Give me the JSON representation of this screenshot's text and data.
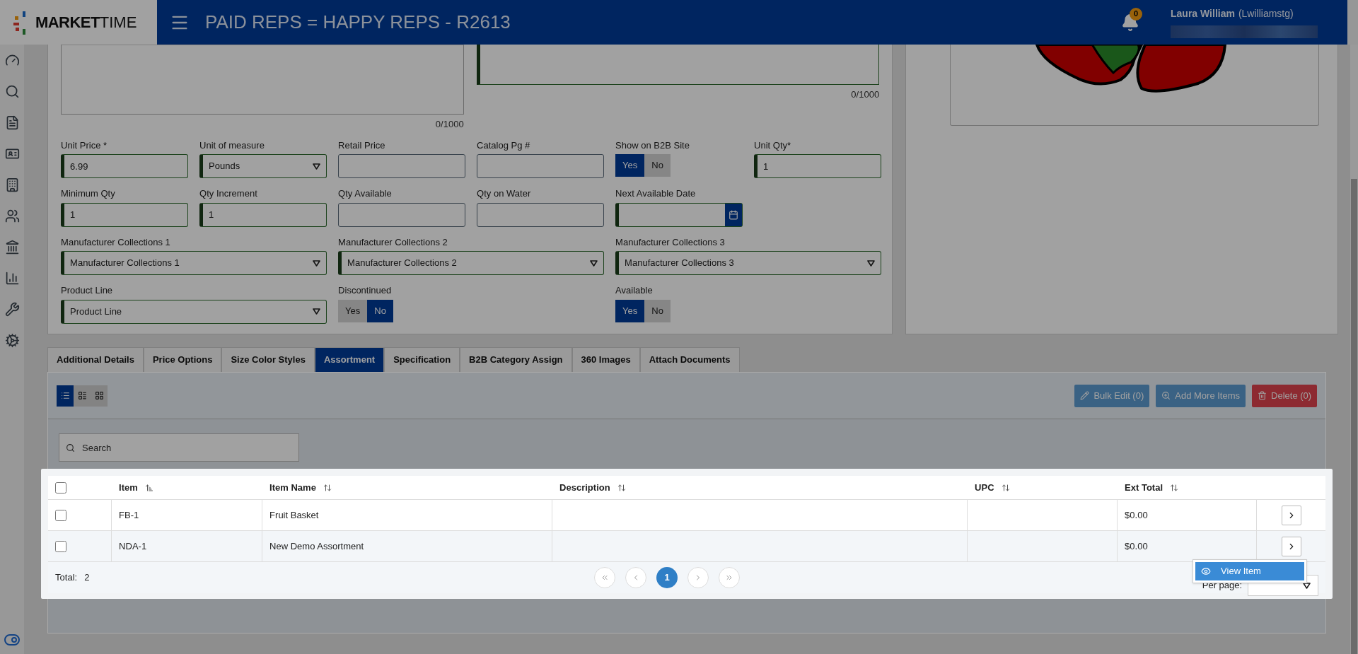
{
  "header": {
    "brand_bold": "MARKET",
    "brand_light": "TIME",
    "title": "PAID REPS = HAPPY REPS - R2613",
    "notification_count": "0",
    "user_name": "Laura William",
    "user_login": "(Lwilliamstg)"
  },
  "form": {
    "counters": [
      "0/1000",
      "0/1000"
    ],
    "rows": [
      [
        {
          "kind": "input",
          "label": "Unit Price *",
          "value": "6.99",
          "validated": true
        },
        {
          "kind": "select",
          "label": "Unit of measure",
          "value": "Pounds",
          "validated": true
        },
        {
          "kind": "input",
          "label": "Retail Price",
          "validated": false
        },
        {
          "kind": "input",
          "label": "Catalog Pg #",
          "validated": false
        },
        {
          "kind": "toggle",
          "label": "Show on B2B Site",
          "options": [
            {
              "label": "Yes",
              "selected": true
            },
            {
              "label": "No",
              "selected": false
            }
          ]
        },
        {
          "kind": "input",
          "label": "Unit Qty*",
          "value": "1",
          "validated": true
        }
      ],
      [
        {
          "kind": "input",
          "label": "Minimum Qty",
          "value": "1",
          "validated": true
        },
        {
          "kind": "input",
          "label": "Qty Increment",
          "value": "1",
          "validated": true
        },
        {
          "kind": "input",
          "label": "Qty Available",
          "validated": false
        },
        {
          "kind": "input",
          "label": "Qty on Water",
          "validated": false
        },
        {
          "kind": "date",
          "label": "Next Available Date",
          "validated": true
        }
      ],
      [
        {
          "kind": "select",
          "label": "Manufacturer Collections 1",
          "value": "Manufacturer Collections 1",
          "validated": true
        },
        {
          "kind": "select",
          "label": "Manufacturer Collections 2",
          "value": "Manufacturer Collections 2",
          "validated": true
        },
        {
          "kind": "select",
          "label": "Manufacturer Collections 3",
          "value": "Manufacturer Collections 3",
          "validated": true
        }
      ],
      [
        {
          "kind": "select",
          "label": "Product Line",
          "value": "Product Line",
          "validated": true
        },
        {
          "kind": "toggle",
          "label": "Discontinued",
          "options": [
            {
              "label": "Yes",
              "selected": false
            },
            {
              "label": "No",
              "selected": true
            }
          ]
        },
        {
          "kind": "toggle",
          "label": "Available",
          "options": [
            {
              "label": "Yes",
              "selected": true
            },
            {
              "label": "No",
              "selected": false
            }
          ]
        }
      ]
    ]
  },
  "tabs": [
    {
      "label": "Additional Details",
      "selected": false
    },
    {
      "label": "Price Options",
      "selected": false
    },
    {
      "label": "Size Color Styles",
      "selected": false
    },
    {
      "label": "Assortment",
      "selected": true
    },
    {
      "label": "Specification",
      "selected": false
    },
    {
      "label": "B2B Category Assign",
      "selected": false
    },
    {
      "label": "360 Images",
      "selected": false
    },
    {
      "label": "Attach Documents",
      "selected": false
    }
  ],
  "view_modes": [
    {
      "kind": "list",
      "selected": true
    },
    {
      "kind": "detail",
      "selected": false
    },
    {
      "kind": "grid",
      "selected": false
    }
  ],
  "actions": [
    {
      "kind": "edit",
      "label": "Bulk Edit (0)"
    },
    {
      "kind": "add",
      "label": "Add More Items"
    },
    {
      "kind": "delete",
      "label": "Delete (0)"
    }
  ],
  "search": {
    "placeholder": "Search"
  },
  "table": {
    "select_all": {
      "checked": false
    },
    "columns": [
      {
        "label": "Item",
        "sorted": true
      },
      {
        "label": "Item Name",
        "sorted": false
      },
      {
        "label": "Description",
        "sorted": false
      },
      {
        "label": "UPC",
        "sorted": false
      },
      {
        "label": "Ext Total",
        "sorted": false
      }
    ],
    "rows": [
      {
        "checked": false,
        "cells": [
          "FB-1",
          "Fruit Basket",
          "",
          "",
          "$0.00"
        ]
      },
      {
        "checked": false,
        "cells": [
          "NDA-1",
          "New Demo Assortment",
          "",
          "",
          "$0.00"
        ]
      }
    ],
    "row_menu": {
      "label": "View Item"
    },
    "footer": {
      "total_label": "Total:",
      "total_value": "2",
      "pages": [
        {
          "label": "1",
          "selected": true
        }
      ],
      "per_page_label": "Per page:"
    }
  }
}
